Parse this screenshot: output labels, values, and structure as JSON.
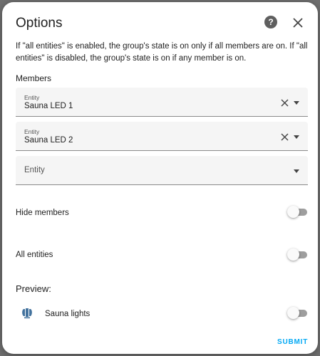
{
  "dialog": {
    "title": "Options",
    "help_icon_glyph": "?",
    "description": "If \"all entities\" is enabled, the group's state is on only if all members are on. If \"all entities\" is disabled, the group's state is on if any member is on."
  },
  "members": {
    "label": "Members",
    "entities": [
      {
        "label": "Entity",
        "value": "Sauna LED 1"
      },
      {
        "label": "Entity",
        "value": "Sauna LED 2"
      }
    ],
    "empty_placeholder": "Entity"
  },
  "options": {
    "hide_members": {
      "label": "Hide members",
      "on": false
    },
    "all_entities": {
      "label": "All entities",
      "on": false
    }
  },
  "preview": {
    "label": "Preview:",
    "entity_name": "Sauna lights",
    "entity_icon": "light-group-icon",
    "on": false
  },
  "actions": {
    "submit_label": "SUBMIT"
  },
  "colors": {
    "accent": "#03a9f4",
    "preview_icon": "#44739e",
    "toggle_off_track": "#9e9e9e"
  }
}
